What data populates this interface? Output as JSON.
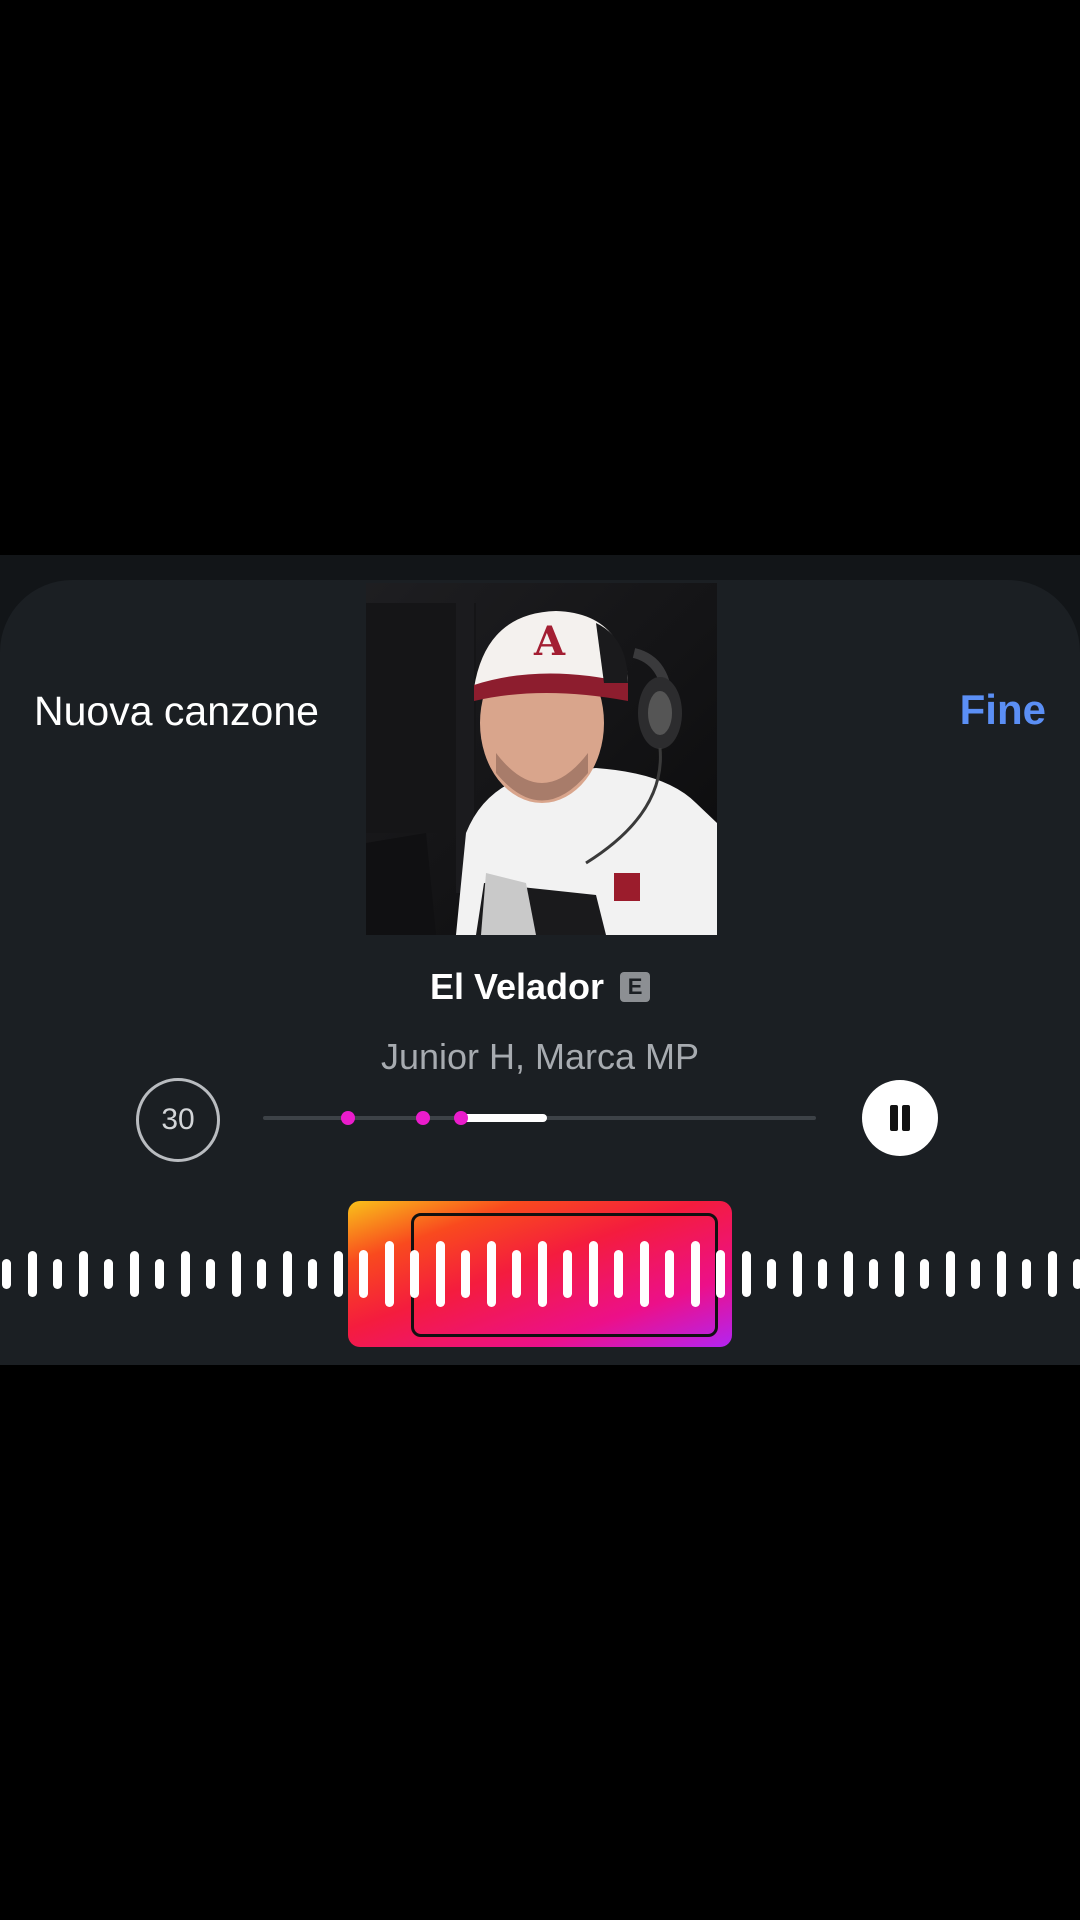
{
  "header": {
    "left_label": "Nuova canzone",
    "done_label": "Fine"
  },
  "song": {
    "title": "El Velador",
    "explicit_badge": "E",
    "artist": "Junior H, Marca MP",
    "cover_icon": "album-cover"
  },
  "controls": {
    "duration_label": "30",
    "play_state_icon": "pause-icon"
  },
  "colors": {
    "accent_link": "#5b8ff5",
    "marker": "#ea1ccb",
    "sheet_background": "#1b1f23"
  }
}
